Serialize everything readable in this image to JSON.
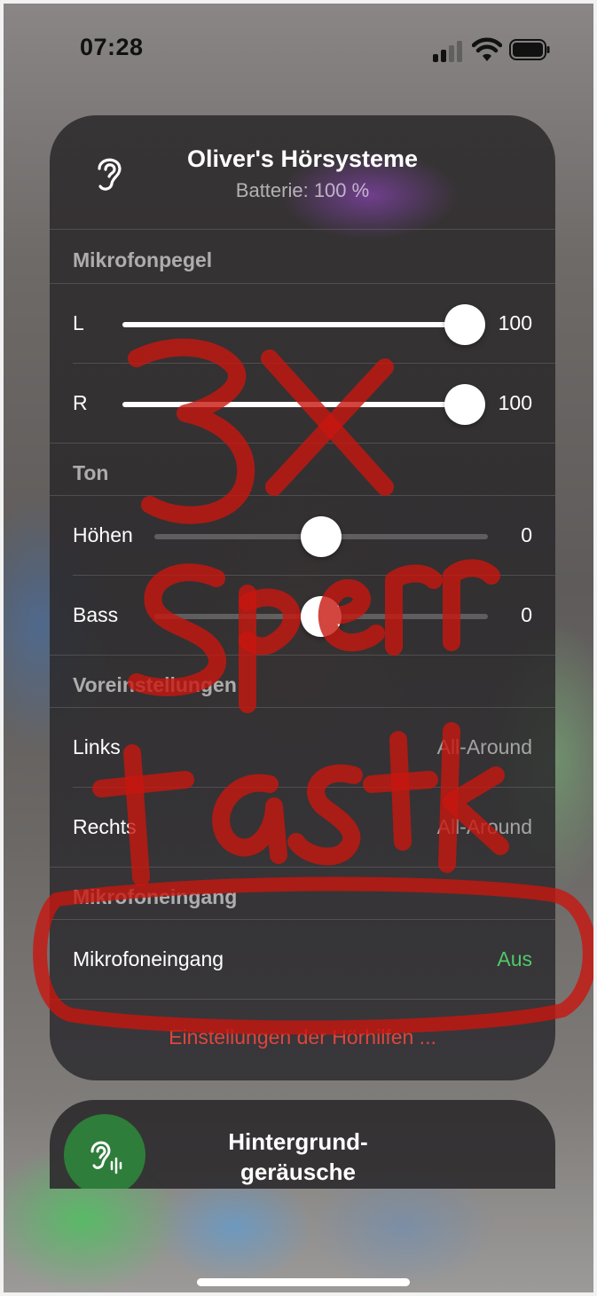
{
  "status": {
    "time": "07:28"
  },
  "device": {
    "title": "Oliver's Hörsysteme",
    "battery": "Batterie: 100 %"
  },
  "sections": {
    "mic_level": "Mikrofonpegel",
    "tone": "Ton",
    "presets": "Voreinstellungen",
    "mic_input": "Mikrofoneingang"
  },
  "mic_level": {
    "left": {
      "label": "L",
      "value": "100",
      "level": 1.0
    },
    "right": {
      "label": "R",
      "value": "100",
      "level": 1.0
    }
  },
  "tone": {
    "treble": {
      "label": "Höhen",
      "value": "0",
      "level": 0.5
    },
    "bass": {
      "label": "Bass",
      "value": "0",
      "level": 0.5
    }
  },
  "presets": {
    "left": {
      "label": "Links",
      "value": "All-Around"
    },
    "right": {
      "label": "Rechts",
      "value": "All-Around"
    }
  },
  "mic_input": {
    "label": "Mikrofoneingang",
    "value": "Aus"
  },
  "footer_link": "Einstellungen der Hörhilfen ...",
  "background_sounds": {
    "title_line1": "Hintergrund-",
    "title_line2": "geräusche"
  },
  "colors": {
    "accent_green": "#4fc86a",
    "link_red": "#e0453c",
    "annotation_red": "#c8160f"
  },
  "icons": [
    "cellular-signal-icon",
    "wifi-icon",
    "battery-icon",
    "ear-icon",
    "ear-waveform-icon"
  ]
}
